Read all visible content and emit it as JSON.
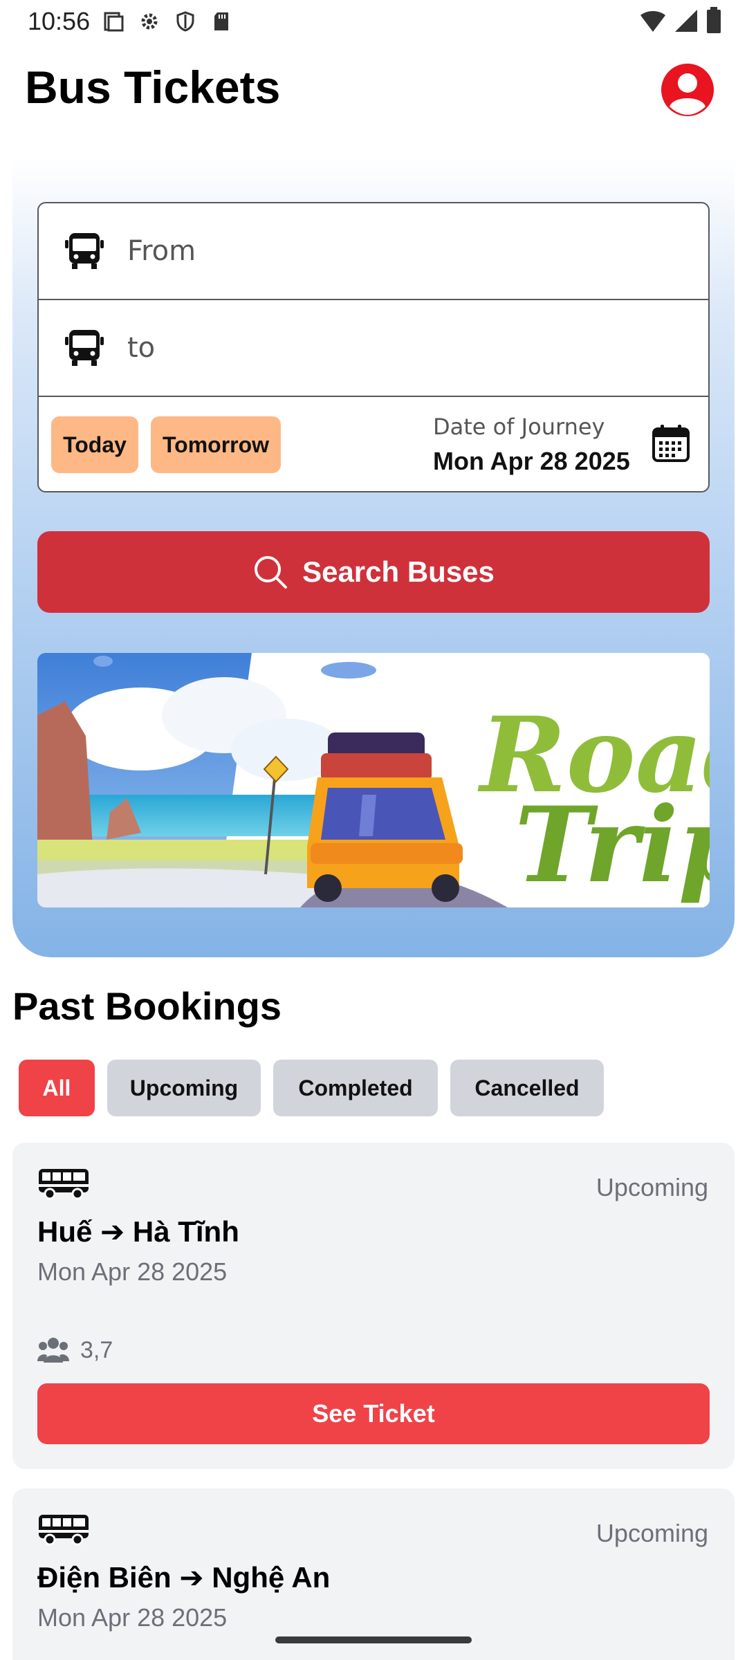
{
  "status_bar": {
    "time": "10:56"
  },
  "header": {
    "title": "Bus Tickets"
  },
  "search": {
    "from_placeholder": "From",
    "to_placeholder": "to",
    "today_label": "Today",
    "tomorrow_label": "Tomorrow",
    "date_label": "Date of Journey",
    "date_value": "Mon Apr 28 2025",
    "button_label": "Search Buses"
  },
  "banner": {
    "title_line1": "Road",
    "title_line2": "Trip"
  },
  "bookings": {
    "section_title": "Past Bookings",
    "filters": [
      {
        "label": "All",
        "active": true
      },
      {
        "label": "Upcoming",
        "active": false
      },
      {
        "label": "Completed",
        "active": false
      },
      {
        "label": "Cancelled",
        "active": false
      }
    ],
    "items": [
      {
        "status": "Upcoming",
        "route": "Huế ➔ Hà Tĩnh",
        "date": "Mon Apr 28 2025",
        "passengers": "3,7",
        "button_label": "See Ticket"
      },
      {
        "status": "Upcoming",
        "route": "Điện Biên ➔ Nghệ An",
        "date": "Mon Apr 28 2025"
      }
    ]
  },
  "colors": {
    "primary_red": "#cf313a",
    "accent_red": "#ef4348",
    "chip_orange": "#fdb885",
    "chip_gray": "#d1d4da"
  }
}
